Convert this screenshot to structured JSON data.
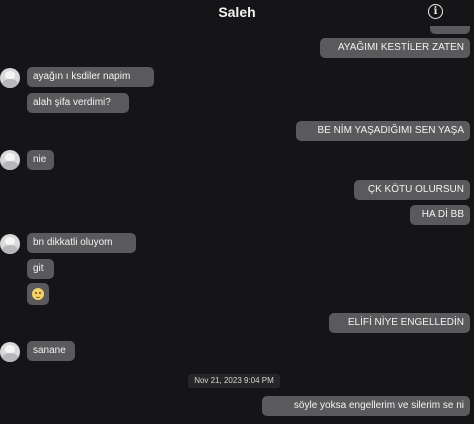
{
  "header": {
    "title": "Saleh",
    "info_icon_glyph": "i"
  },
  "messages": [
    {
      "side": "right",
      "text": "AYAĞIMI KESTİLER ZATEN"
    },
    {
      "side": "left",
      "text": "ayağın ı ksdiler napim"
    },
    {
      "side": "left",
      "text": "alah şifa verdimi?"
    },
    {
      "side": "right",
      "text": "BE NİM YAŞADIĞIMI SEN YAŞA"
    },
    {
      "side": "left",
      "text": "nie"
    },
    {
      "side": "right",
      "text": "ÇK KÖTU OLURSUN"
    },
    {
      "side": "right",
      "text": "HA Dİ BB"
    },
    {
      "side": "left",
      "text": "bn dikkatli oluyom"
    },
    {
      "side": "left",
      "text": "git"
    },
    {
      "side": "left",
      "emoji": "slightly-smiling-face"
    },
    {
      "side": "right",
      "text": "ELİFİ NİYE ENGELLEDİN"
    },
    {
      "side": "left",
      "text": "sanane"
    },
    {
      "side": "right",
      "text": "söyle yoksa engellerim ve silerim se ni"
    }
  ],
  "timestamp": "Nov 21, 2023 9:04 PM",
  "colors": {
    "background": "#151517",
    "bubble": "#5a5a5d",
    "text": "#f3f3f3"
  }
}
